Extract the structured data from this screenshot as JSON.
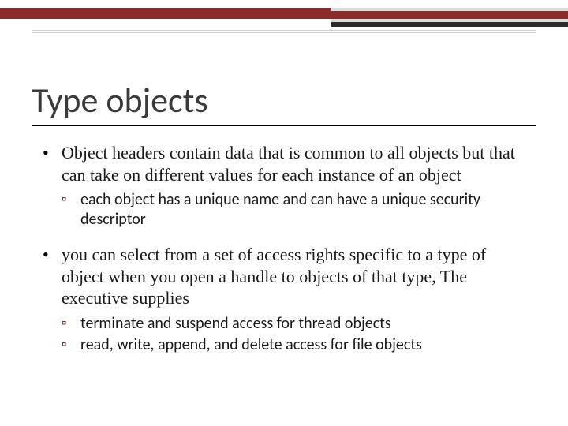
{
  "title": "Type objects",
  "bullets": [
    {
      "text": "Object headers contain data that is common to all objects but that can take on different values for each instance of an object",
      "sub": [
        "each object has a unique name and can have a unique security descriptor"
      ]
    },
    {
      "text": "you can select from a set of access rights specific to a type of object when you open a handle to objects of that type, The executive supplies",
      "sub": [
        "terminate and suspend access for thread objects",
        "read, write, append, and delete access for file objects"
      ]
    }
  ]
}
